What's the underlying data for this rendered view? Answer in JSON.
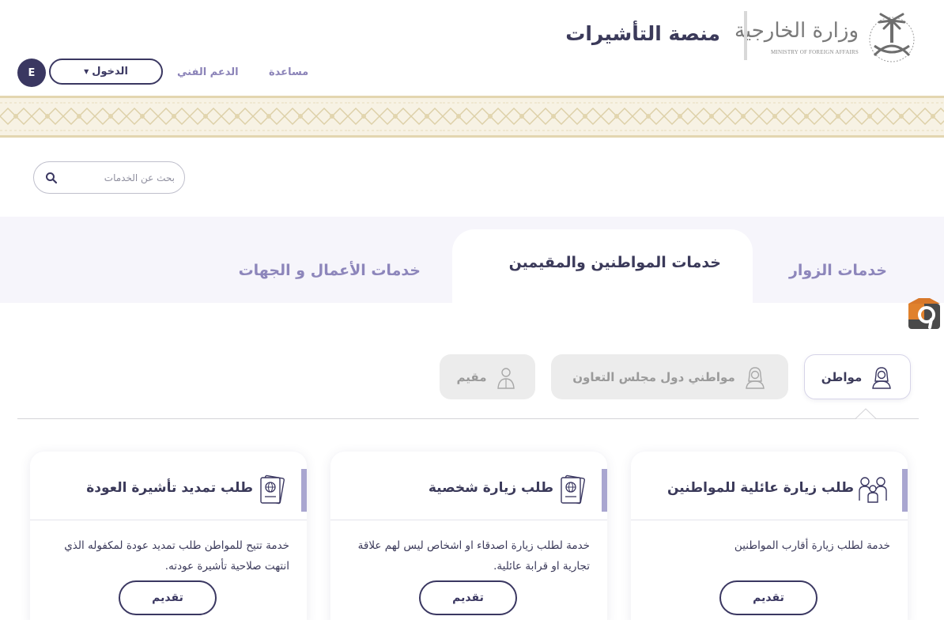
{
  "header": {
    "ministry_ar": "وزارة الخارجية",
    "ministry_en": "MINISTRY OF FOREIGN AFFAIRS",
    "platform_title": "منصة التأشيرات",
    "nav": {
      "help": "مساعدة",
      "support": "الدعم الفني"
    },
    "login_label": "الدخول",
    "language_label": "E"
  },
  "search": {
    "placeholder": "بحث عن الخدمات"
  },
  "tabs": [
    {
      "label": "خدمات الزوار",
      "active": false
    },
    {
      "label": "خدمات المواطنين والمقيمين",
      "active": true
    },
    {
      "label": "خدمات الأعمال و الجهات",
      "active": false
    }
  ],
  "subtabs": [
    {
      "label": "مواطن",
      "active": true
    },
    {
      "label": "مواطني دول مجلس التعاون",
      "active": false
    },
    {
      "label": "مقيم",
      "active": false
    }
  ],
  "cards": [
    {
      "title": "طلب زيارة عائلية للمواطنين",
      "description": "خدمة لطلب زيارة أقارب المواطنين",
      "button": "تقديم",
      "icon": "family-icon"
    },
    {
      "title": "طلب زيارة شخصية",
      "description": "خدمة لطلب زيارة اصدقاء او اشخاص ليس لهم علاقة تجارية او قرابة عائلية.",
      "button": "تقديم",
      "icon": "passport-icon"
    },
    {
      "title": "طلب تمديد تأشيرة العودة",
      "description": "خدمة تتيح للمواطن طلب تمديد عودة لمكفوله الذي انتهت صلاحية تأشيرة عودته.",
      "button": "تقديم",
      "icon": "passport-icon"
    }
  ],
  "colors": {
    "primary": "#3a3761",
    "accent": "#8d86bb",
    "band": "#f7f2e4",
    "band_border": "#e3d6b0"
  }
}
